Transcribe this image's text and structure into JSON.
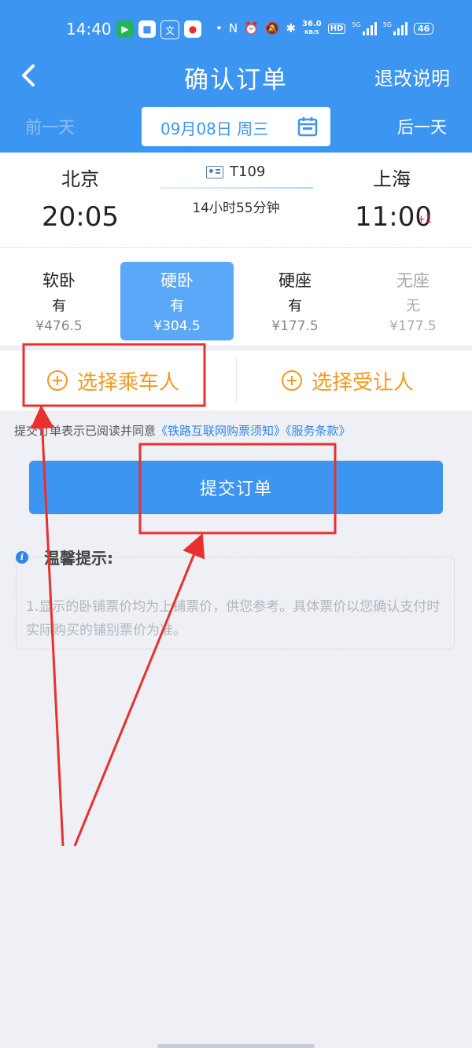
{
  "status_bar": {
    "time": "14:40",
    "net_speed_value": "36.0",
    "net_speed_unit": "KB/S",
    "hd_label": "HD",
    "signal_1": "5G",
    "signal_2": "5G",
    "battery": "46"
  },
  "navbar": {
    "back_icon": "chevron-left-icon",
    "title": "确认订单",
    "rules_link": "退改说明"
  },
  "date_bar": {
    "prev_day": "前一天",
    "date": "09月08日 周三",
    "next_day": "后一天",
    "calendar_icon": "calendar-icon"
  },
  "train": {
    "from_station": "北京",
    "to_station": "上海",
    "train_no": "T109",
    "departure_time": "20:05",
    "arrival_time": "11:00",
    "arrival_day_offset": "+1",
    "duration": "14小时55分钟"
  },
  "seats": [
    {
      "name": "软卧",
      "availability": "有",
      "price": "¥476.5",
      "state": "normal"
    },
    {
      "name": "硬卧",
      "availability": "有",
      "price": "¥304.5",
      "state": "selected"
    },
    {
      "name": "硬座",
      "availability": "有",
      "price": "¥177.5",
      "state": "normal"
    },
    {
      "name": "无座",
      "availability": "无",
      "price": "¥177.5",
      "state": "disabled"
    }
  ],
  "passenger": {
    "choose_passenger": "选择乘车人",
    "choose_beneficiary": "选择受让人"
  },
  "agreement": {
    "prefix": "提交订单表示已阅读并同意",
    "link_1": "《铁路互联网购票须知》",
    "link_2": "《服务条款》"
  },
  "submit_label": "提交订单",
  "tips": {
    "title": "温馨提示:",
    "content": "1.显示的卧铺票价均为上铺票价，供您参考。具体票价以您确认支付时实际购买的铺别票价为准。"
  },
  "colors": {
    "brand_blue": "#3d95f2",
    "accent_orange": "#f39a22",
    "annotation_red": "#e8312f",
    "seat_selected": "#5aa8f7"
  }
}
